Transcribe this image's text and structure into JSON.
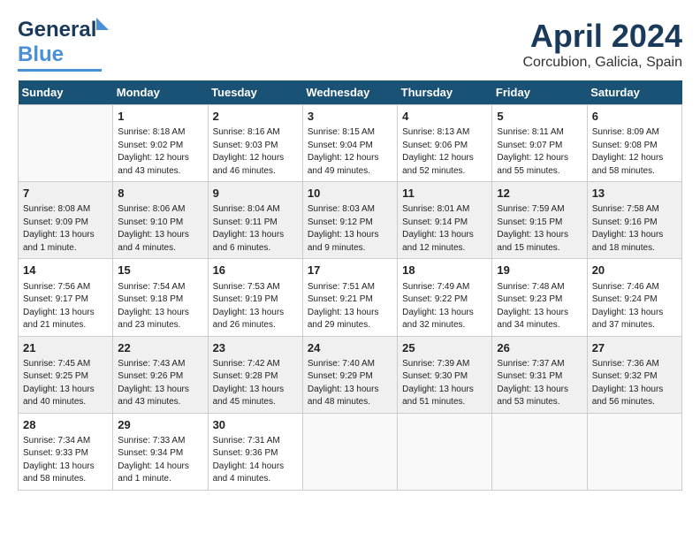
{
  "header": {
    "logo_line1": "General",
    "logo_line2": "Blue",
    "month": "April 2024",
    "location": "Corcubion, Galicia, Spain"
  },
  "days_of_week": [
    "Sunday",
    "Monday",
    "Tuesday",
    "Wednesday",
    "Thursday",
    "Friday",
    "Saturday"
  ],
  "weeks": [
    [
      {
        "day": "",
        "info": ""
      },
      {
        "day": "1",
        "info": "Sunrise: 8:18 AM\nSunset: 9:02 PM\nDaylight: 12 hours\nand 43 minutes."
      },
      {
        "day": "2",
        "info": "Sunrise: 8:16 AM\nSunset: 9:03 PM\nDaylight: 12 hours\nand 46 minutes."
      },
      {
        "day": "3",
        "info": "Sunrise: 8:15 AM\nSunset: 9:04 PM\nDaylight: 12 hours\nand 49 minutes."
      },
      {
        "day": "4",
        "info": "Sunrise: 8:13 AM\nSunset: 9:06 PM\nDaylight: 12 hours\nand 52 minutes."
      },
      {
        "day": "5",
        "info": "Sunrise: 8:11 AM\nSunset: 9:07 PM\nDaylight: 12 hours\nand 55 minutes."
      },
      {
        "day": "6",
        "info": "Sunrise: 8:09 AM\nSunset: 9:08 PM\nDaylight: 12 hours\nand 58 minutes."
      }
    ],
    [
      {
        "day": "7",
        "info": "Sunrise: 8:08 AM\nSunset: 9:09 PM\nDaylight: 13 hours\nand 1 minute."
      },
      {
        "day": "8",
        "info": "Sunrise: 8:06 AM\nSunset: 9:10 PM\nDaylight: 13 hours\nand 4 minutes."
      },
      {
        "day": "9",
        "info": "Sunrise: 8:04 AM\nSunset: 9:11 PM\nDaylight: 13 hours\nand 6 minutes."
      },
      {
        "day": "10",
        "info": "Sunrise: 8:03 AM\nSunset: 9:12 PM\nDaylight: 13 hours\nand 9 minutes."
      },
      {
        "day": "11",
        "info": "Sunrise: 8:01 AM\nSunset: 9:14 PM\nDaylight: 13 hours\nand 12 minutes."
      },
      {
        "day": "12",
        "info": "Sunrise: 7:59 AM\nSunset: 9:15 PM\nDaylight: 13 hours\nand 15 minutes."
      },
      {
        "day": "13",
        "info": "Sunrise: 7:58 AM\nSunset: 9:16 PM\nDaylight: 13 hours\nand 18 minutes."
      }
    ],
    [
      {
        "day": "14",
        "info": "Sunrise: 7:56 AM\nSunset: 9:17 PM\nDaylight: 13 hours\nand 21 minutes."
      },
      {
        "day": "15",
        "info": "Sunrise: 7:54 AM\nSunset: 9:18 PM\nDaylight: 13 hours\nand 23 minutes."
      },
      {
        "day": "16",
        "info": "Sunrise: 7:53 AM\nSunset: 9:19 PM\nDaylight: 13 hours\nand 26 minutes."
      },
      {
        "day": "17",
        "info": "Sunrise: 7:51 AM\nSunset: 9:21 PM\nDaylight: 13 hours\nand 29 minutes."
      },
      {
        "day": "18",
        "info": "Sunrise: 7:49 AM\nSunset: 9:22 PM\nDaylight: 13 hours\nand 32 minutes."
      },
      {
        "day": "19",
        "info": "Sunrise: 7:48 AM\nSunset: 9:23 PM\nDaylight: 13 hours\nand 34 minutes."
      },
      {
        "day": "20",
        "info": "Sunrise: 7:46 AM\nSunset: 9:24 PM\nDaylight: 13 hours\nand 37 minutes."
      }
    ],
    [
      {
        "day": "21",
        "info": "Sunrise: 7:45 AM\nSunset: 9:25 PM\nDaylight: 13 hours\nand 40 minutes."
      },
      {
        "day": "22",
        "info": "Sunrise: 7:43 AM\nSunset: 9:26 PM\nDaylight: 13 hours\nand 43 minutes."
      },
      {
        "day": "23",
        "info": "Sunrise: 7:42 AM\nSunset: 9:28 PM\nDaylight: 13 hours\nand 45 minutes."
      },
      {
        "day": "24",
        "info": "Sunrise: 7:40 AM\nSunset: 9:29 PM\nDaylight: 13 hours\nand 48 minutes."
      },
      {
        "day": "25",
        "info": "Sunrise: 7:39 AM\nSunset: 9:30 PM\nDaylight: 13 hours\nand 51 minutes."
      },
      {
        "day": "26",
        "info": "Sunrise: 7:37 AM\nSunset: 9:31 PM\nDaylight: 13 hours\nand 53 minutes."
      },
      {
        "day": "27",
        "info": "Sunrise: 7:36 AM\nSunset: 9:32 PM\nDaylight: 13 hours\nand 56 minutes."
      }
    ],
    [
      {
        "day": "28",
        "info": "Sunrise: 7:34 AM\nSunset: 9:33 PM\nDaylight: 13 hours\nand 58 minutes."
      },
      {
        "day": "29",
        "info": "Sunrise: 7:33 AM\nSunset: 9:34 PM\nDaylight: 14 hours\nand 1 minute."
      },
      {
        "day": "30",
        "info": "Sunrise: 7:31 AM\nSunset: 9:36 PM\nDaylight: 14 hours\nand 4 minutes."
      },
      {
        "day": "",
        "info": ""
      },
      {
        "day": "",
        "info": ""
      },
      {
        "day": "",
        "info": ""
      },
      {
        "day": "",
        "info": ""
      }
    ]
  ],
  "stripe_colors": [
    "#ffffff",
    "#f0f0f0",
    "#ffffff",
    "#f0f0f0",
    "#ffffff"
  ]
}
